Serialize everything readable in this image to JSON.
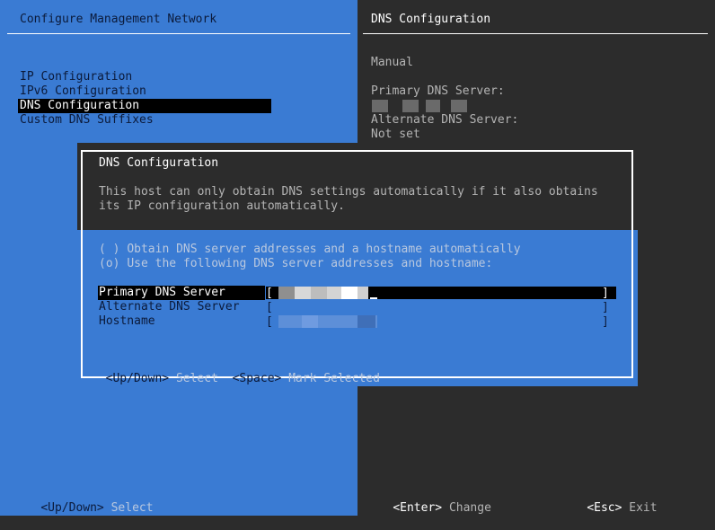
{
  "left": {
    "title": "Configure Management Network",
    "menu": [
      {
        "label": "IP Configuration",
        "selected": false
      },
      {
        "label": "IPv6 Configuration",
        "selected": false
      },
      {
        "label": "DNS Configuration",
        "selected": true
      },
      {
        "label": "Custom DNS Suffixes",
        "selected": false
      }
    ],
    "footer_key": "<Up/Down>",
    "footer_action": "Select"
  },
  "right": {
    "title": "DNS Configuration",
    "mode": "Manual",
    "primary_label": "Primary DNS Server:",
    "alternate_label": "Alternate DNS Server:",
    "alternate_value": "Not set",
    "footer_enter_key": "<Enter>",
    "footer_enter_action": "Change",
    "footer_esc_key": "<Esc>",
    "footer_esc_action": "Exit"
  },
  "dialog": {
    "title": "DNS Configuration",
    "description_line1": "This host can only obtain DNS settings automatically if it also obtains",
    "description_line2": "its IP configuration automatically.",
    "options": [
      {
        "marker": "( )",
        "label": "Obtain DNS server addresses and a hostname automatically"
      },
      {
        "marker": "(o)",
        "label": "Use the following DNS server addresses and hostname:"
      }
    ],
    "fields": [
      {
        "label": "Primary DNS Server",
        "active": true
      },
      {
        "label": "Alternate DNS Server",
        "active": false
      },
      {
        "label": "Hostname",
        "active": false
      }
    ],
    "bracket_open": "[",
    "bracket_close": "]",
    "footer_updown_key": "<Up/Down>",
    "footer_updown_action": "Select",
    "footer_space_key": "<Space>",
    "footer_space_action": "Mark Selected"
  },
  "colors": {
    "blue_panel": "#3a7bd3",
    "dark_panel": "#2c2c2c",
    "menu_text": "#0b1a3a",
    "highlight": "#000000"
  }
}
